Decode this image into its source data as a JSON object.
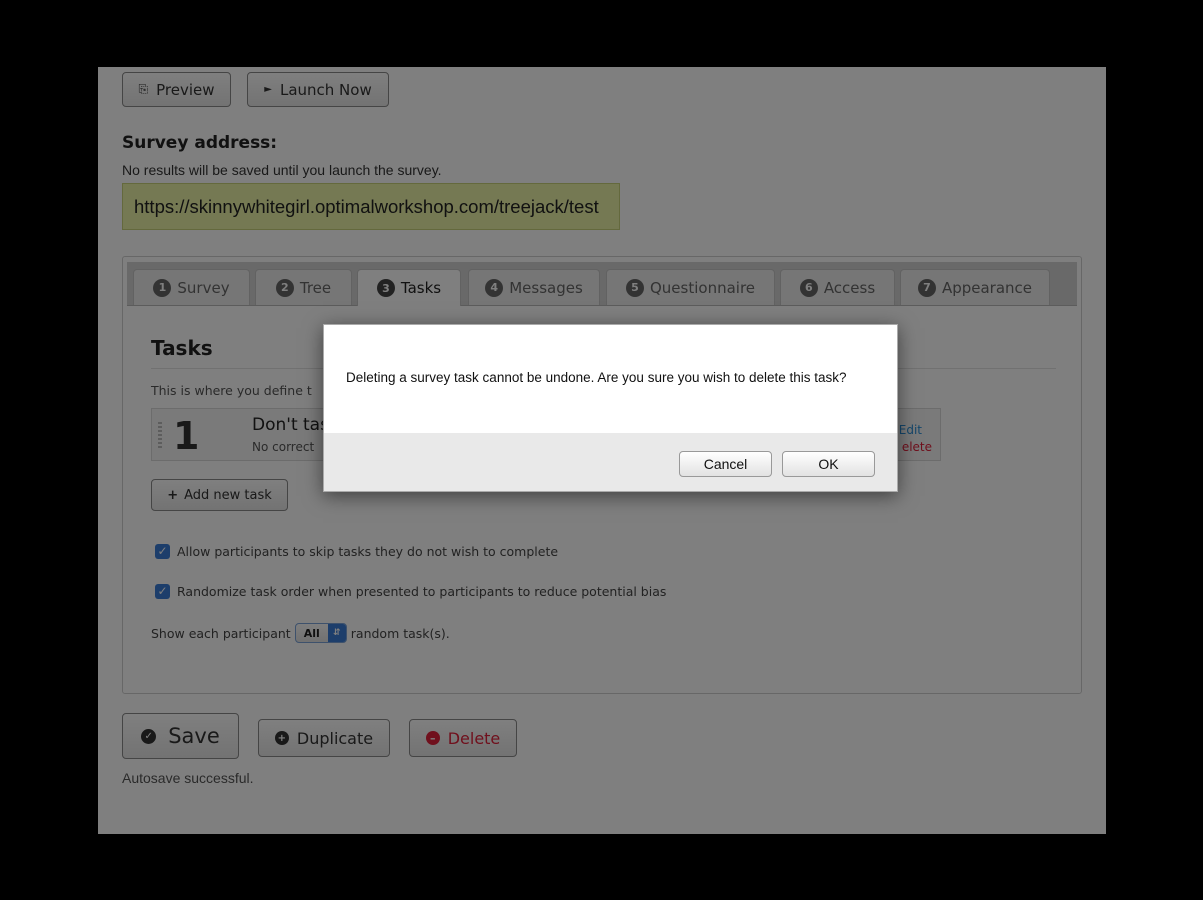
{
  "toolbar": {
    "preview_label": "Preview",
    "launch_label": "Launch Now"
  },
  "survey": {
    "address_heading": "Survey address:",
    "note": "No results will be saved until you launch the survey.",
    "url": "https://skinnywhitegirl.optimalworkshop.com/treejack/test"
  },
  "tabs": [
    {
      "num": "1",
      "label": "Survey"
    },
    {
      "num": "2",
      "label": "Tree"
    },
    {
      "num": "3",
      "label": "Tasks"
    },
    {
      "num": "4",
      "label": "Messages"
    },
    {
      "num": "5",
      "label": "Questionnaire"
    },
    {
      "num": "6",
      "label": "Access"
    },
    {
      "num": "7",
      "label": "Appearance"
    }
  ],
  "active_tab": "Tasks",
  "tasks": {
    "heading": "Tasks",
    "description": "This is where you define t",
    "items": [
      {
        "number": "1",
        "title": "Don't tas",
        "subtitle": "No correct",
        "edit_label": "Edit",
        "delete_label": "elete"
      }
    ],
    "add_label": "Add new task",
    "options": [
      {
        "checked": true,
        "label": "Allow participants to skip tasks they do not wish to complete"
      },
      {
        "checked": true,
        "label": "Randomize task order when presented to participants to reduce potential bias"
      }
    ],
    "show_prefix": "Show each participant",
    "show_value": "All",
    "show_suffix": "random task(s)."
  },
  "footer": {
    "save_label": "Save",
    "duplicate_label": "Duplicate",
    "delete_label": "Delete",
    "autosave": "Autosave successful."
  },
  "dialog": {
    "message": "Deleting a survey task cannot be undone. Are you sure you wish to delete this task?",
    "cancel_label": "Cancel",
    "ok_label": "OK"
  },
  "colors": {
    "url_bg": "#eaf3a6",
    "accent_blue": "#3a7cd6",
    "delete_red": "#e0213a",
    "overlay": "rgba(0,0,0,0.5)"
  }
}
